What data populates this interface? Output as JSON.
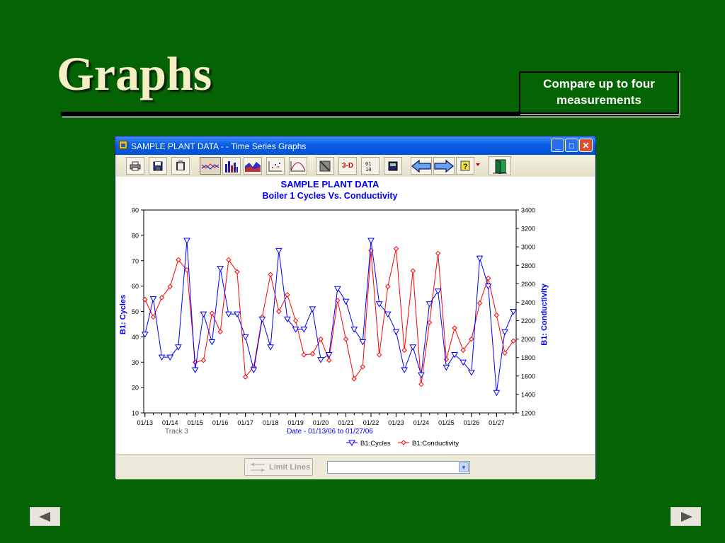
{
  "slide": {
    "title": "Graphs",
    "callout": "Compare up to four measurements"
  },
  "window": {
    "title": "SAMPLE PLANT DATA -  - Time Series Graphs",
    "buttons": {
      "minimize": "_",
      "maximize": "□",
      "close": "✕"
    }
  },
  "toolbar": {
    "three_d_label": "3-D",
    "zero_one_label": "01\n10",
    "icons": [
      "print-icon",
      "save-icon",
      "clipboard-icon",
      "line-chart-icon",
      "bar-chart-icon",
      "area-chart-icon",
      "scatter-chart-icon",
      "curve-chart-icon",
      "diagonal-icon",
      "3d-icon",
      "values-icon",
      "calculator-icon",
      "back-arrow-icon",
      "forward-arrow-icon",
      "help-icon",
      "exit-door-icon"
    ]
  },
  "chart_data": {
    "type": "line",
    "title": "SAMPLE PLANT DATA",
    "subtitle": "Boiler 1 Cycles Vs. Conductivity",
    "xlabel": "Date - 01/13/06 to 01/27/06",
    "ylabel": "B1: Cycles",
    "y2label": "B1: Conductivity",
    "footnote": "Track 3",
    "x_ticks": [
      "01/13",
      "01/14",
      "01/15",
      "01/16",
      "01/17",
      "01/18",
      "01/19",
      "01/20",
      "01/21",
      "01/22",
      "01/23",
      "01/24",
      "01/25",
      "01/26",
      "01/27"
    ],
    "x_range": [
      13,
      27.7
    ],
    "ylim": [
      10,
      90
    ],
    "y_ticks": [
      10,
      20,
      30,
      40,
      50,
      60,
      70,
      80,
      90
    ],
    "y2lim": [
      1200,
      3400
    ],
    "y2_ticks": [
      1200,
      1400,
      1600,
      1800,
      2000,
      2200,
      2400,
      2600,
      2800,
      3000,
      3200,
      3400
    ],
    "grid": false,
    "legend_position": "bottom-right",
    "series": [
      {
        "name": "B1:Cycles",
        "axis": "left",
        "color": "#0000ff",
        "marker": "triangle-down",
        "x": [
          13,
          13.33,
          13.67,
          14,
          14.33,
          14.67,
          15,
          15.33,
          15.67,
          16,
          16.33,
          16.67,
          17,
          17.33,
          17.67,
          18,
          18.33,
          18.67,
          19,
          19.33,
          19.67,
          20,
          20.33,
          20.67,
          21,
          21.33,
          21.67,
          22,
          22.33,
          22.67,
          23,
          23.33,
          23.67,
          24,
          24.33,
          24.67,
          25,
          25.33,
          25.67,
          26,
          26.33,
          26.67,
          27,
          27.33,
          27.67
        ],
        "values": [
          41,
          55,
          32,
          32,
          36,
          78,
          27,
          49,
          38,
          67,
          49,
          49,
          40,
          27,
          47,
          36,
          74,
          47,
          43,
          43,
          51,
          31,
          33,
          59,
          54,
          43,
          38,
          78,
          53,
          49,
          42,
          27,
          36,
          25,
          53,
          58,
          28,
          33,
          30,
          26,
          71,
          60,
          18,
          42,
          50
        ]
      },
      {
        "name": "B1:Conductivity",
        "axis": "right",
        "color": "#ff0000",
        "marker": "diamond",
        "x": [
          13,
          13.33,
          13.67,
          14,
          14.33,
          14.67,
          15,
          15.33,
          15.67,
          16,
          16.33,
          16.67,
          17,
          17.33,
          17.67,
          18,
          18.33,
          18.67,
          19,
          19.33,
          19.67,
          20,
          20.33,
          20.67,
          21,
          21.33,
          21.67,
          22,
          22.33,
          22.67,
          23,
          23.33,
          23.67,
          24,
          24.33,
          24.67,
          25,
          25.33,
          25.67,
          26,
          26.33,
          26.67,
          27,
          27.33,
          27.67
        ],
        "values": [
          2430,
          2240,
          2450,
          2570,
          2860,
          2750,
          1750,
          1770,
          2280,
          2080,
          2860,
          2730,
          1590,
          1700,
          2240,
          2700,
          2300,
          2480,
          2200,
          1830,
          1840,
          2000,
          1770,
          2420,
          2000,
          1570,
          1700,
          2960,
          1830,
          2570,
          2980,
          1880,
          2740,
          1510,
          2180,
          2930,
          1780,
          2120,
          1880,
          2000,
          2390,
          2660,
          2260,
          1850,
          1980
        ]
      }
    ]
  }
}
